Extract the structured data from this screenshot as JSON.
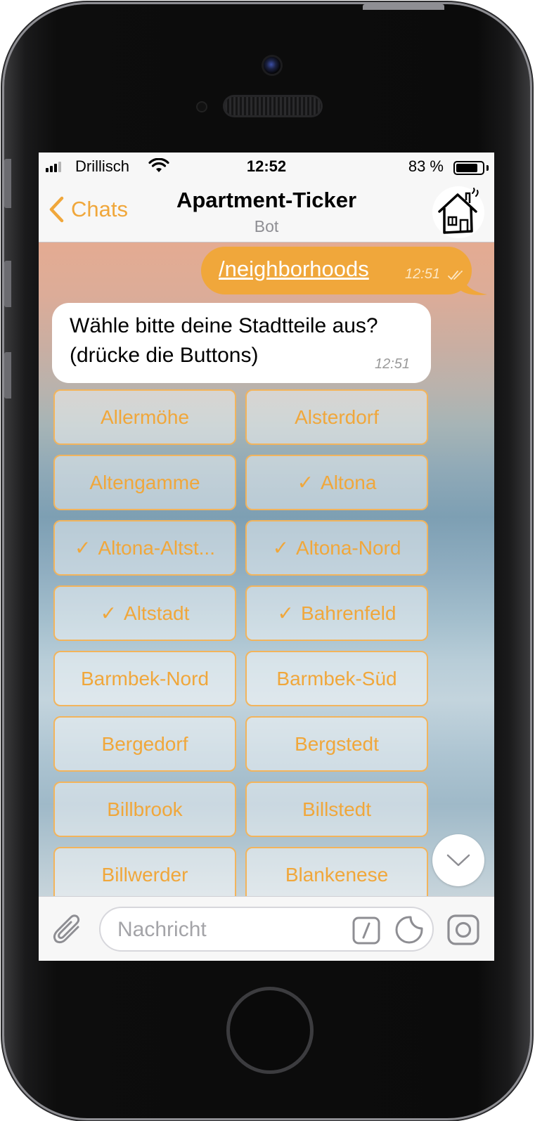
{
  "status_bar": {
    "carrier": "Drillisch",
    "time": "12:52",
    "battery_percent": "83 %",
    "battery_level": 0.83
  },
  "nav": {
    "back_label": "Chats",
    "title": "Apartment-Ticker",
    "subtitle": "Bot"
  },
  "messages": [
    {
      "direction": "outgoing",
      "text": "/neighborhoods",
      "time": "12:51",
      "status": "read-double-check"
    },
    {
      "direction": "incoming",
      "text": "Wähle bitte deine Stadtteile aus? (drücke die Buttons)",
      "time": "12:51"
    }
  ],
  "keyboard": {
    "check_glyph": "✓",
    "buttons": [
      {
        "label": "Allermöhe",
        "checked": false
      },
      {
        "label": "Alsterdorf",
        "checked": false
      },
      {
        "label": "Altengamme",
        "checked": false
      },
      {
        "label": "Altona",
        "checked": true
      },
      {
        "label": "Altona-Altst...",
        "checked": true
      },
      {
        "label": "Altona-Nord",
        "checked": true
      },
      {
        "label": "Altstadt",
        "checked": true
      },
      {
        "label": "Bahrenfeld",
        "checked": true
      },
      {
        "label": "Barmbek-Nord",
        "checked": false
      },
      {
        "label": "Barmbek-Süd",
        "checked": false
      },
      {
        "label": "Bergedorf",
        "checked": false
      },
      {
        "label": "Bergstedt",
        "checked": false
      },
      {
        "label": "Billbrook",
        "checked": false
      },
      {
        "label": "Billstedt",
        "checked": false
      },
      {
        "label": "Billwerder",
        "checked": false
      },
      {
        "label": "Blankenese",
        "checked": false
      }
    ]
  },
  "input": {
    "placeholder": "Nachricht"
  },
  "colors": {
    "accent": "#f0a73b",
    "outgoing_bubble": "#f0a73b",
    "incoming_bubble": "#ffffff",
    "button_border": "#f2b45c"
  },
  "icons": [
    "back-chevron-icon",
    "bot-house-avatar",
    "attach-paperclip-icon",
    "bot-command-icon",
    "sticker-icon",
    "camera-icon",
    "chevron-down-icon",
    "wifi-icon",
    "signal-icon",
    "battery-icon"
  ]
}
